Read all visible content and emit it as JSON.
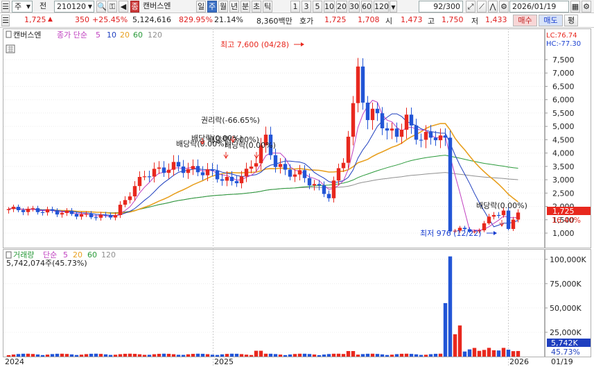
{
  "toolbar": {
    "market_select": "주",
    "prev_label": "전",
    "code": "210120",
    "name_badge": "종",
    "stock_name": "캔버스엔",
    "periods": [
      "일",
      "주",
      "월",
      "년",
      "분",
      "초",
      "틱"
    ],
    "active_period": "주",
    "intervals": [
      "1",
      "3",
      "5",
      "10",
      "20",
      "30",
      "60",
      "120"
    ],
    "page_counter": "92/300",
    "date": "2026/01/19"
  },
  "quote": {
    "price": "1,725",
    "change_arrow": "▲",
    "change": "350",
    "change_pct": "+25.45%",
    "volume": "5,124,616",
    "vol_ratio": "829.95%",
    "turnover": "21.14%",
    "amount": "8,360백만",
    "ask_label": "호가",
    "ask1": "1,725",
    "ask2": "1,708",
    "open_label": "시",
    "open": "1,473",
    "high_label": "고",
    "high": "1,750",
    "low_label": "저",
    "low": "1,433",
    "buy_label": "매수",
    "sell_label": "매도",
    "eval_label": "평"
  },
  "price_panel": {
    "stock_label": "캔버스엔",
    "legend_prefix": "종가 단순",
    "ma_periods": [
      "5",
      "10",
      "20",
      "60",
      "120"
    ],
    "lc_label": "LC:76.74",
    "hc_label": "HC:-77.30",
    "yaxis": [
      "7,500",
      "7,000",
      "6,500",
      "6,000",
      "5,500",
      "5,000",
      "4,500",
      "4,000",
      "3,500",
      "3,000",
      "2,500",
      "2,000",
      "1,500",
      "1,000"
    ],
    "current_tag": "1,725",
    "current_pct_tag": "16.40%",
    "annotations": {
      "high": "최고 7,600 (04/28)",
      "low": "최저 976 (12/22)",
      "rights": "권리락(-66.65%)",
      "dividend1": "배당락(0.00%)",
      "dividend2": "배당락(0.00%)",
      "dividend3": "배당락(0.00%)",
      "dividend4": "배당락(0.00%)",
      "dividend5": "배당락(0.00%)"
    }
  },
  "volume_panel": {
    "label": "거래량",
    "legend_prefix": "단순",
    "ma_periods": [
      "5",
      "20",
      "60",
      "120"
    ],
    "current_volume": "5,742,074주(45.73%)",
    "yaxis": [
      "100,000K",
      "75,000K",
      "50,000K",
      "25,000K"
    ],
    "current_tag": "5,742K",
    "current_pct_tag": "45.73%"
  },
  "xaxis": [
    "2024",
    "2025",
    "2026",
    "01/19"
  ],
  "colors": {
    "up": "#e8281e",
    "down": "#2255d6",
    "ma5": "#c040c0",
    "ma10": "#1f3fbf",
    "ma20": "#e8a020",
    "ma60": "#2a9a3a",
    "ma120": "#909090"
  }
}
